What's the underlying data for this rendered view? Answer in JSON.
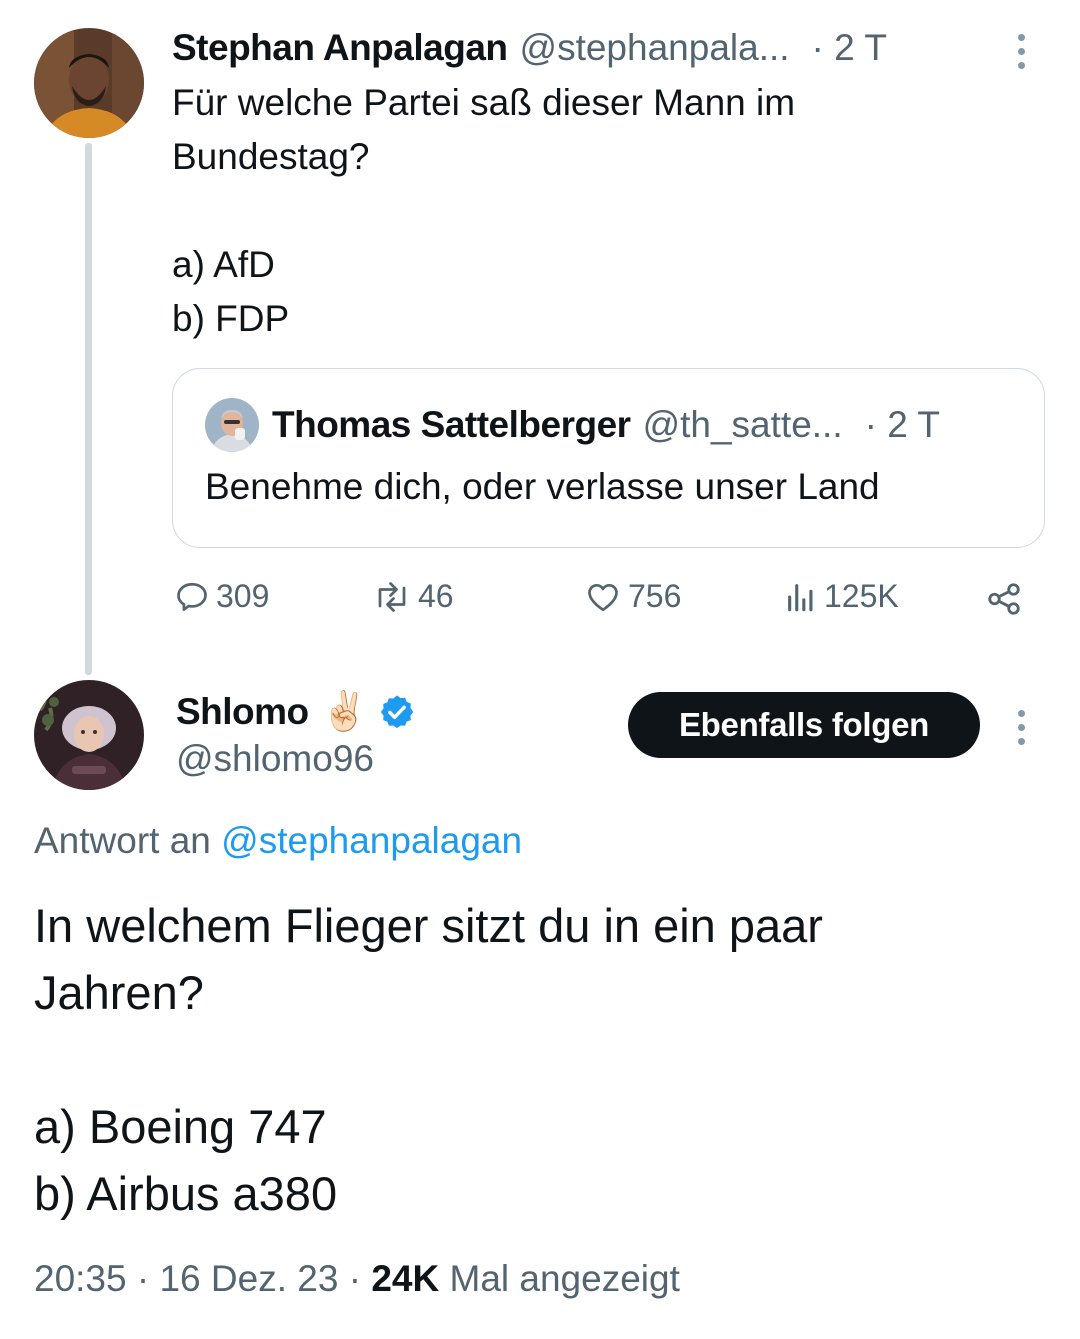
{
  "first_tweet": {
    "author_name": "Stephan Anpalagan",
    "handle": "@stephanpala...",
    "time": "· 2 T",
    "text": "Für welche Partei saß dieser Mann im\nBundestag?\n\na) AfD\nb) FDP",
    "quote": {
      "author_name": "Thomas Sattelberger",
      "handle": "@th_satte...",
      "time": "· 2 T",
      "text": "Benehme dich, oder verlasse unser Land"
    },
    "actions": {
      "replies": "309",
      "retweets": "46",
      "likes": "756",
      "views": "125K"
    }
  },
  "main_tweet": {
    "author_name": "Shlomo",
    "emoji": "✌🏻",
    "handle": "@shlomo96",
    "follow_button": "Ebenfalls folgen",
    "reply_prefix": "Antwort an",
    "reply_to": "@stephanpalagan",
    "text": "In welchem Flieger sitzt du in ein paar\nJahren?\n\na) Boeing 747\nb) Airbus a380",
    "time": "20:35",
    "date": "16 Dez. 23",
    "views_count": "24K",
    "views_label": "Mal angezeigt"
  },
  "colors": {
    "link": "#1d9bf0",
    "muted": "#536471",
    "verified": "#1d9bf0",
    "button_bg": "#0f1419"
  },
  "icons": [
    "reply-icon",
    "retweet-icon",
    "like-icon",
    "views-icon",
    "share-icon",
    "more-icon",
    "verified-badge-icon"
  ]
}
